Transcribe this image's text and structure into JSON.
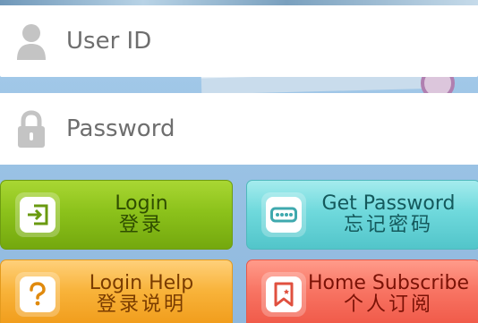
{
  "form": {
    "user_id": {
      "placeholder": "User ID",
      "value": "",
      "icon": "user-icon"
    },
    "password": {
      "placeholder": "Password",
      "value": "",
      "icon": "lock-icon"
    }
  },
  "actions": {
    "login": {
      "label_en": "Login",
      "label_zh": "登录",
      "icon": "login-enter-icon",
      "color": "#8cc21b"
    },
    "get_password": {
      "label_en": "Get Password",
      "label_zh": "忘记密码",
      "icon": "password-dots-icon",
      "color": "#6fd9dc"
    },
    "login_help": {
      "label_en": "Login Help",
      "label_zh": "登录说明",
      "icon": "question-icon",
      "color": "#f8b33a"
    },
    "home_subscribe": {
      "label_en": "Home Subscribe",
      "label_zh": "个人订阅",
      "icon": "bookmark-icon",
      "color": "#f87463"
    }
  }
}
